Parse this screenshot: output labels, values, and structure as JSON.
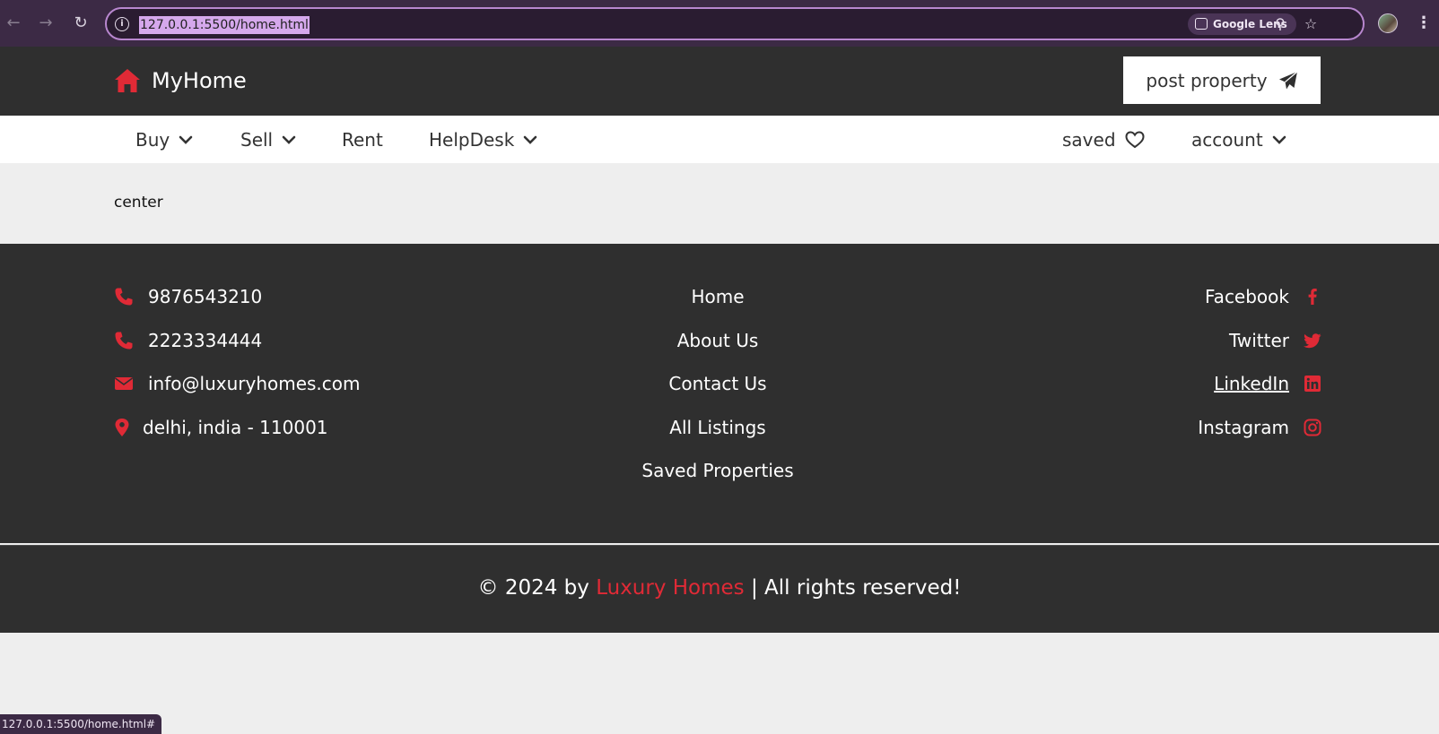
{
  "browser": {
    "url": "127.0.0.1:5500/home.html",
    "lens_label": "Google Lens",
    "status_url": "127.0.0.1:5500/home.html#"
  },
  "header": {
    "brand": "MyHome",
    "post_button": "post property"
  },
  "nav": {
    "left": [
      {
        "label": "Buy",
        "dropdown": true
      },
      {
        "label": "Sell",
        "dropdown": true
      },
      {
        "label": "Rent",
        "dropdown": false
      },
      {
        "label": "HelpDesk",
        "dropdown": true
      }
    ],
    "saved": "saved",
    "account": "account"
  },
  "main": {
    "center_text": "center"
  },
  "footer": {
    "contacts": [
      {
        "icon": "phone-icon",
        "text": "9876543210"
      },
      {
        "icon": "phone-icon",
        "text": "2223334444"
      },
      {
        "icon": "envelope-icon",
        "text": "info@luxuryhomes.com"
      },
      {
        "icon": "map-marker-icon",
        "text": "delhi, india - 110001"
      }
    ],
    "links": [
      "Home",
      "About Us",
      "Contact Us",
      "All Listings",
      "Saved Properties"
    ],
    "social": [
      {
        "label": "Facebook",
        "icon": "facebook-icon"
      },
      {
        "label": "Twitter",
        "icon": "twitter-icon"
      },
      {
        "label": "LinkedIn",
        "icon": "linkedin-icon"
      },
      {
        "label": "Instagram",
        "icon": "instagram-icon"
      }
    ],
    "copyright_prefix": "© 2024 by ",
    "copyright_brand": "Luxury Homes",
    "copyright_suffix": " | All rights reserved!"
  },
  "colors": {
    "accent": "#e02a36",
    "dark": "#2f2f2f",
    "light": "#eeeeee"
  }
}
